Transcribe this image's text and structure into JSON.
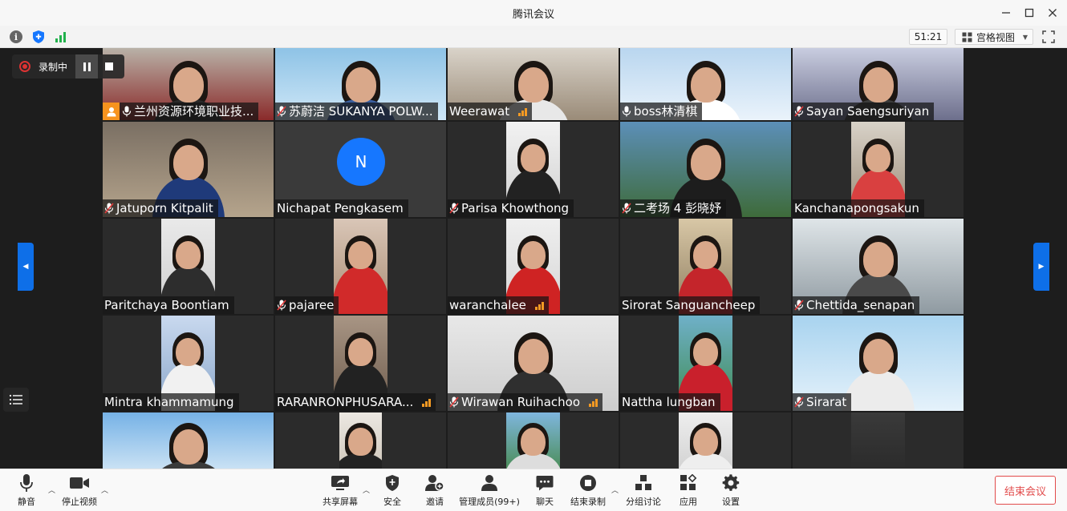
{
  "window": {
    "title": "腾讯会议"
  },
  "infobar": {
    "timer": "51:21",
    "view_label": "宫格视图"
  },
  "recording": {
    "label": "录制中"
  },
  "participants": [
    {
      "name": "兰州资源环境职业技...",
      "host": true,
      "mic": "on"
    },
    {
      "name": "苏蔚洁 SUKANYA POLW...",
      "mic": "muted"
    },
    {
      "name": "Weerawat",
      "signal": true
    },
    {
      "name": "boss林清棋",
      "mic": "on"
    },
    {
      "name": "Sayan Saengsuriyan",
      "mic": "muted"
    },
    {
      "name": "Jatuporn Kitpalit",
      "mic": "muted"
    },
    {
      "name": "Nichapat Pengkasem",
      "avatar": "N"
    },
    {
      "name": "Parisa Khowthong",
      "mic": "muted"
    },
    {
      "name": "二考场 4 彭晓妤",
      "mic": "muted"
    },
    {
      "name": "Kanchanapongsakun"
    },
    {
      "name": "Paritchaya Boontiam"
    },
    {
      "name": "pajaree",
      "mic": "muted"
    },
    {
      "name": "waranchalee",
      "signal": true
    },
    {
      "name": "Sirorat Sanguancheep"
    },
    {
      "name": "Chettida_senapan",
      "mic": "muted"
    },
    {
      "name": "Mintra khammamung"
    },
    {
      "name": "RARANRONPHUSARA...",
      "signal": true
    },
    {
      "name": "Wirawan Ruihachoo",
      "mic": "muted",
      "signal": true
    },
    {
      "name": "Nattha lungban"
    },
    {
      "name": "Sirarat",
      "mic": "muted"
    },
    {
      "name": ""
    },
    {
      "name": ""
    },
    {
      "name": ""
    },
    {
      "name": ""
    },
    {
      "name": ""
    }
  ],
  "toolbar": {
    "mute": "静音",
    "stop_video": "停止视频",
    "share_screen": "共享屏幕",
    "security": "安全",
    "invite": "邀请",
    "members": "管理成员(99+)",
    "chat": "聊天",
    "end_recording": "结束录制",
    "breakout": "分组讨论",
    "apps": "应用",
    "settings": "设置",
    "end_meeting": "结束会议"
  },
  "colors": {
    "accent": "#1677ff",
    "danger": "#e24b4b",
    "signal": "#f59a23"
  }
}
